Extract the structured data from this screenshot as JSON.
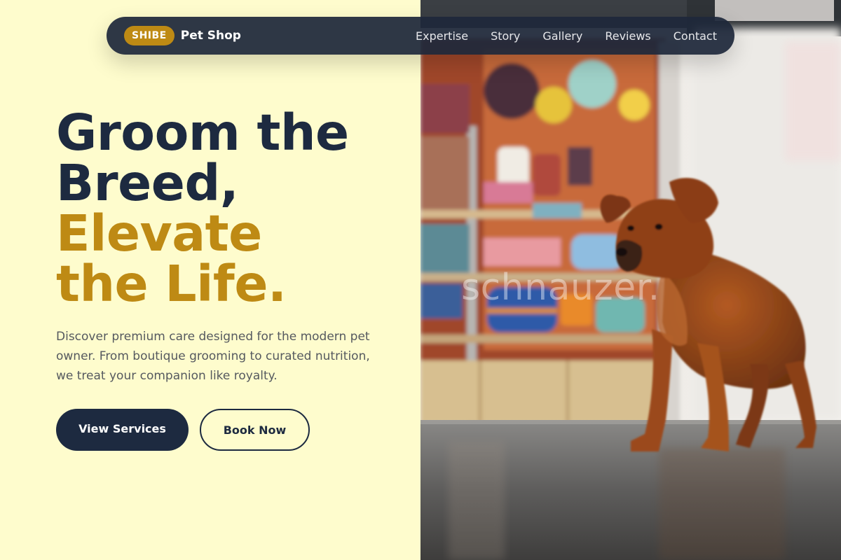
{
  "brand": {
    "badge": "SHIBE",
    "name": "Pet Shop"
  },
  "nav": {
    "links": [
      "Expertise",
      "Story",
      "Gallery",
      "Reviews",
      "Contact"
    ]
  },
  "hero": {
    "headline_line1": "Groom the",
    "headline_line2": "Breed,",
    "headline_line3": "Elevate",
    "headline_line4": "the Life.",
    "description": "Discover premium care designed for the modern pet owner. From boutique grooming to curated nutrition, we treat your companion like royalty.",
    "primary_cta": "View Services",
    "secondary_cta": "Book Now"
  },
  "photo": {
    "watermark": "schnauzer.tokyo"
  },
  "colors": {
    "background": "#fefccd",
    "navy": "#1d2a40",
    "gold": "#be8a14",
    "body_text": "#55595f"
  }
}
